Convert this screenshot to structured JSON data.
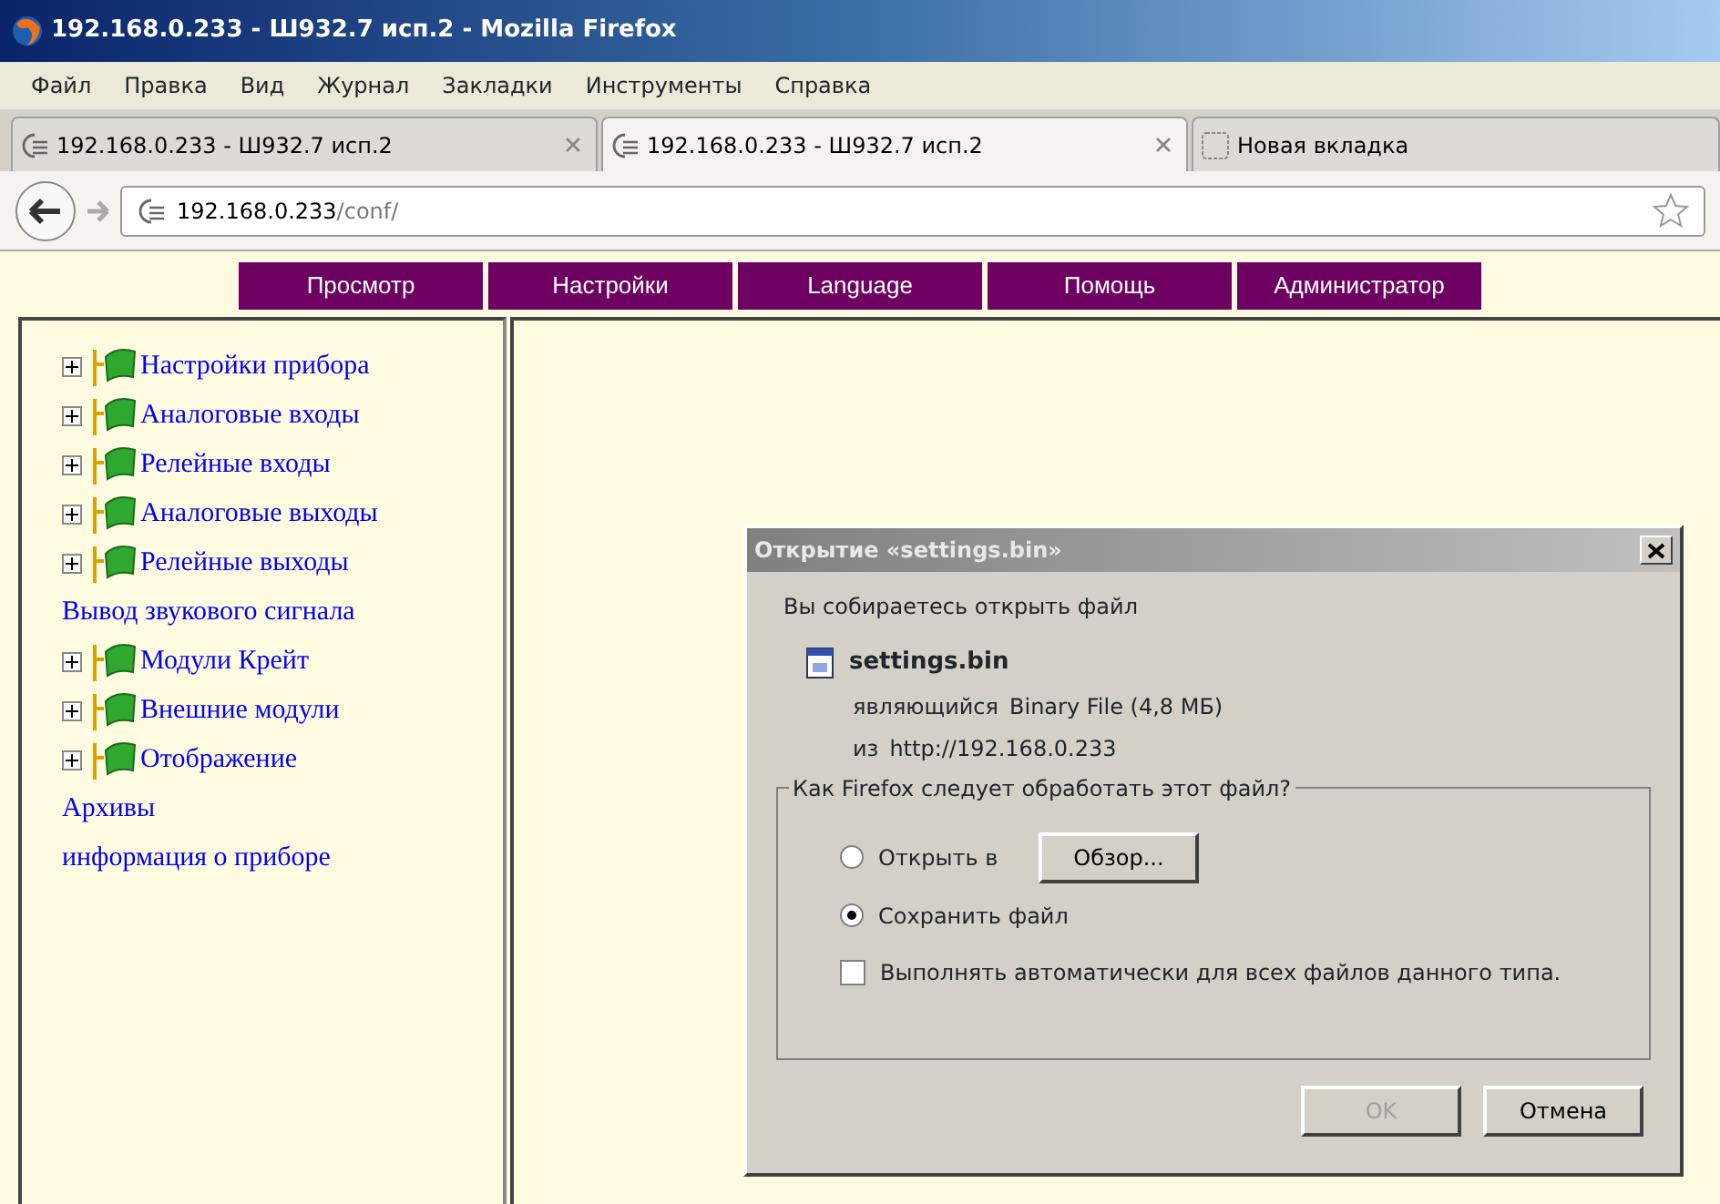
{
  "window": {
    "title": "192.168.0.233 - Ш932.7 исп.2 - Mozilla Firefox"
  },
  "menu": [
    "Файл",
    "Правка",
    "Вид",
    "Журнал",
    "Закладки",
    "Инструменты",
    "Справка"
  ],
  "tabs": [
    {
      "label": "192.168.0.233 - Ш932.7 исп.2",
      "selected": false,
      "closable": true
    },
    {
      "label": "192.168.0.233 - Ш932.7 исп.2",
      "selected": true,
      "closable": true
    },
    {
      "label": "Новая вкладка",
      "selected": false,
      "closable": false
    }
  ],
  "address": {
    "host": "192.168.0.233",
    "path": "/conf/"
  },
  "site_menu": [
    "Просмотр",
    "Настройки",
    "Language",
    "Помощь",
    "Администратор"
  ],
  "sidebar": {
    "items": [
      {
        "label": "Настройки прибора",
        "kind": "folder",
        "expanded": false
      },
      {
        "label": "Аналоговые входы",
        "kind": "folder",
        "expanded": false
      },
      {
        "label": "Релейные входы",
        "kind": "folder",
        "expanded": false
      },
      {
        "label": "Аналоговые выходы",
        "kind": "folder",
        "expanded": false
      },
      {
        "label": "Релейные выходы",
        "kind": "folder",
        "expanded": false
      },
      {
        "label": "Вывод звукового сигнала",
        "kind": "link"
      },
      {
        "label": "Модули Крейт",
        "kind": "folder",
        "expanded": false
      },
      {
        "label": "Внешние модули",
        "kind": "folder",
        "expanded": false
      },
      {
        "label": "Отображение",
        "kind": "folder",
        "expanded": false
      },
      {
        "label": "Архивы",
        "kind": "link"
      },
      {
        "label": "информация о приборе",
        "kind": "link"
      }
    ]
  },
  "dialog": {
    "title": "Открытие «settings.bin»",
    "intro": "Вы собираетесь открыть файл",
    "file_name": "settings.bin",
    "type_label": "являющийся",
    "type_value": "Binary File (4,8 МБ)",
    "from_label": "из",
    "from_value": "http://192.168.0.233",
    "group_title": "Как Firefox следует обработать этот файл?",
    "options": [
      {
        "label": "Открыть в",
        "selected": false,
        "browse": "Обзор..."
      },
      {
        "label": "Сохранить файл",
        "selected": true
      }
    ],
    "auto": {
      "label": "Выполнять автоматически для всех файлов данного типа.",
      "checked": false
    },
    "buttons": [
      {
        "label": "OK",
        "disabled": true
      },
      {
        "label": "Отмена",
        "disabled": false
      }
    ]
  }
}
